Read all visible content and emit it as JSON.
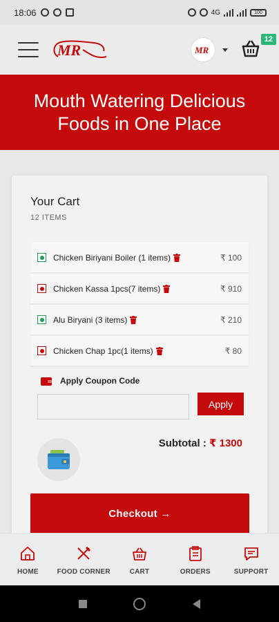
{
  "status_bar": {
    "time": "18:06",
    "network": "4G",
    "battery": "100"
  },
  "header": {
    "logo_text": "MR",
    "cart_badge": "12"
  },
  "hero": {
    "title": "Mouth Watering Delicious Foods in One Place"
  },
  "cart": {
    "title": "Your Cart",
    "count": "12 ITEMS",
    "items": [
      {
        "name": "Chicken Biriyani Boiler (1 items)",
        "price": "₹ 100",
        "type": "veg"
      },
      {
        "name": "Chicken Kassa 1pcs(7 items)",
        "price": "₹ 910",
        "type": "nonveg"
      },
      {
        "name": "Alu Biryani (3 items)",
        "price": "₹ 210",
        "type": "veg"
      },
      {
        "name": "Chicken Chap 1pc(1 items)",
        "price": "₹ 80",
        "type": "nonveg"
      }
    ]
  },
  "coupon": {
    "label": "Apply Coupon Code",
    "placeholder": "",
    "apply_label": "Apply"
  },
  "subtotal": {
    "label": "Subtotal : ",
    "amount": "₹ 1300"
  },
  "checkout": {
    "label": "Checkout →"
  },
  "bottom_nav": [
    {
      "label": "HOME",
      "icon": "home-icon"
    },
    {
      "label": "FOOD CORNER",
      "icon": "fork-knife-icon"
    },
    {
      "label": "CART",
      "icon": "basket-icon"
    },
    {
      "label": "ORDERS",
      "icon": "clipboard-icon"
    },
    {
      "label": "SUPPORT",
      "icon": "chat-icon"
    }
  ],
  "colors": {
    "brand": "#c40a0a",
    "badge": "#2cb57b",
    "veg": "#1f9d55"
  }
}
